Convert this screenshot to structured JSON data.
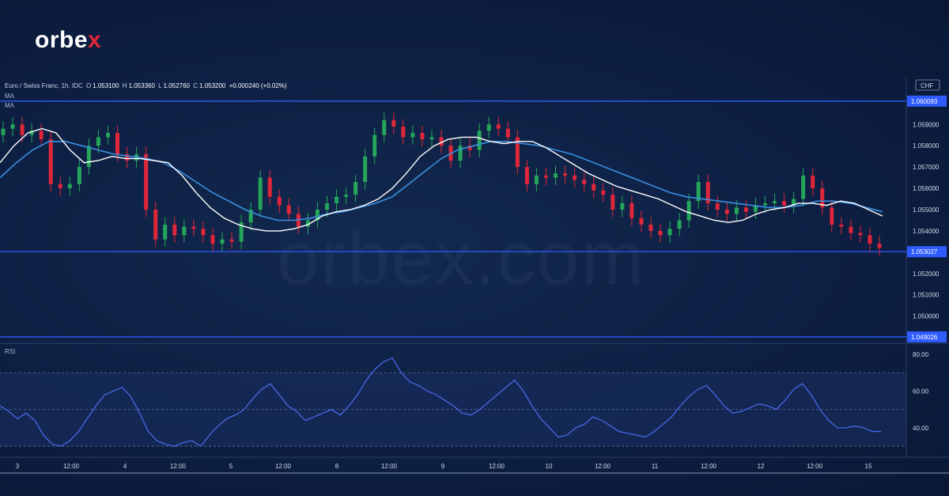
{
  "brand": {
    "logo_text": "orbe",
    "logo_x": "x"
  },
  "watermark": "orbex.com",
  "header": {
    "symbol": "Euro / Swiss Franc, 1h, IDC",
    "o_label": "O",
    "o": "1.053100",
    "h_label": "H",
    "h": "1.053360",
    "l_label": "L",
    "l": "1.052760",
    "c_label": "C",
    "c": "1.053200",
    "change": "+0.000240 (+0.02%)",
    "ma1": "MA",
    "ma2": "MA",
    "currency": "CHF"
  },
  "rsi_label": "RSI",
  "colors": {
    "up": "#26a65b",
    "down": "#e0263a",
    "level_line": "#2f5bff",
    "ma_fast": "#ffffff",
    "ma_slow": "#3a8fe0",
    "rsi": "#4a6cf0"
  },
  "chart_data": [
    {
      "type": "line",
      "title": "",
      "price_ticks": [
        "1.060000",
        "1.059000",
        "1.058000",
        "1.057000",
        "1.056000",
        "1.055000",
        "1.054000",
        "1.053000",
        "1.052000",
        "1.051000",
        "1.050000",
        "1.049000"
      ],
      "ylim": [
        1.0488,
        1.0612
      ],
      "x_ticks": [
        "3",
        "12:00",
        "4",
        "12:00",
        "5",
        "12:00",
        "8",
        "12:00",
        "9",
        "12:00",
        "10",
        "12:00",
        "11",
        "12:00",
        "12",
        "12:00",
        "15"
      ],
      "levels": [
        {
          "label": "1.060093",
          "value": 1.060093
        },
        {
          "label": "1.053027",
          "value": 1.053027
        },
        {
          "label": "1.049026",
          "value": 1.049026
        }
      ],
      "close_series": [
        1.0588,
        1.059,
        1.0585,
        1.0587,
        1.0583,
        1.0562,
        1.056,
        1.0562,
        1.057,
        1.058,
        1.0584,
        1.0586,
        1.0576,
        1.0573,
        1.0576,
        1.055,
        1.0536,
        1.0543,
        1.0538,
        1.0542,
        1.0541,
        1.0538,
        1.0534,
        1.0536,
        1.0535,
        1.0544,
        1.055,
        1.0565,
        1.0556,
        1.0552,
        1.0548,
        1.0542,
        1.0545,
        1.055,
        1.0553,
        1.0556,
        1.0557,
        1.0563,
        1.0575,
        1.0585,
        1.0592,
        1.0589,
        1.0584,
        1.0586,
        1.0583,
        1.0584,
        1.058,
        1.0573,
        1.058,
        1.0578,
        1.0587,
        1.059,
        1.0588,
        1.0584,
        1.057,
        1.0562,
        1.0566,
        1.0565,
        1.0567,
        1.0566,
        1.0564,
        1.0562,
        1.0559,
        1.0557,
        1.055,
        1.0553,
        1.0546,
        1.0543,
        1.054,
        1.0538,
        1.0541,
        1.0545,
        1.0554,
        1.0563,
        1.0553,
        1.055,
        1.0548,
        1.0551,
        1.0549,
        1.0552,
        1.0553,
        1.0554,
        1.0552,
        1.0555,
        1.0566,
        1.056,
        1.0551,
        1.0543,
        1.0542,
        1.0539,
        1.0538,
        1.0534,
        1.0532
      ],
      "ma_fast_series": [
        1.0572,
        1.058,
        1.0586,
        1.0588,
        1.0586,
        1.0578,
        1.0572,
        1.0573,
        1.0575,
        1.0574,
        1.0574,
        1.0573,
        1.0572,
        1.0566,
        1.0558,
        1.0551,
        1.0546,
        1.0543,
        1.0541,
        1.054,
        1.054,
        1.0541,
        1.0543,
        1.0547,
        1.0549,
        1.055,
        1.0552,
        1.0555,
        1.056,
        1.0567,
        1.0575,
        1.058,
        1.0583,
        1.0584,
        1.0584,
        1.0582,
        1.0581,
        1.0582,
        1.0582,
        1.0579,
        1.0575,
        1.0571,
        1.0567,
        1.0564,
        1.0561,
        1.0559,
        1.0557,
        1.0555,
        1.0552,
        1.0549,
        1.0547,
        1.0545,
        1.0544,
        1.0545,
        1.0548,
        1.055,
        1.0551,
        1.0553,
        1.0553,
        1.0552,
        1.0554,
        1.0553,
        1.055,
        1.0547
      ],
      "ma_slow_series": [
        1.0565,
        1.0572,
        1.0578,
        1.0582,
        1.0582,
        1.058,
        1.0578,
        1.0576,
        1.0575,
        1.0574,
        1.0572,
        1.0568,
        1.0563,
        1.0558,
        1.0554,
        1.055,
        1.0547,
        1.0545,
        1.0545,
        1.0546,
        1.0548,
        1.0549,
        1.0551,
        1.0553,
        1.0556,
        1.0562,
        1.0568,
        1.0574,
        1.0578,
        1.058,
        1.0582,
        1.0582,
        1.0581,
        1.058,
        1.0578,
        1.0576,
        1.0573,
        1.057,
        1.0567,
        1.0564,
        1.0561,
        1.0558,
        1.0556,
        1.0555,
        1.0554,
        1.0553,
        1.0552,
        1.0551,
        1.0551,
        1.0552,
        1.0554,
        1.0554,
        1.0553,
        1.0551,
        1.0549
      ]
    },
    {
      "type": "line",
      "title": "RSI",
      "ylim": [
        24,
        86
      ],
      "y_ticks": [
        "80.00",
        "60.00",
        "40.00"
      ],
      "bands": [
        70,
        50,
        30
      ],
      "series": [
        {
          "values": [
            52,
            49,
            45,
            48,
            44,
            36,
            31,
            30,
            33,
            38,
            45,
            52,
            58,
            60,
            62,
            57,
            48,
            38,
            33,
            31,
            30,
            32,
            33,
            30,
            36,
            41,
            45,
            47,
            50,
            56,
            61,
            64,
            58,
            52,
            49,
            44,
            46,
            48,
            50,
            47,
            52,
            58,
            66,
            72,
            76,
            78,
            70,
            65,
            63,
            60,
            58,
            55,
            52,
            48,
            47,
            50,
            54,
            58,
            62,
            66,
            60,
            52,
            45,
            40,
            35,
            36,
            40,
            42,
            46,
            44,
            41,
            38,
            37,
            36,
            35,
            38,
            42,
            46,
            52,
            57,
            61,
            63,
            58,
            52,
            48,
            49,
            51,
            53,
            52,
            50,
            55,
            61,
            64,
            58,
            50,
            44,
            40,
            40,
            41,
            40,
            38,
            38
          ]
        }
      ]
    }
  ]
}
